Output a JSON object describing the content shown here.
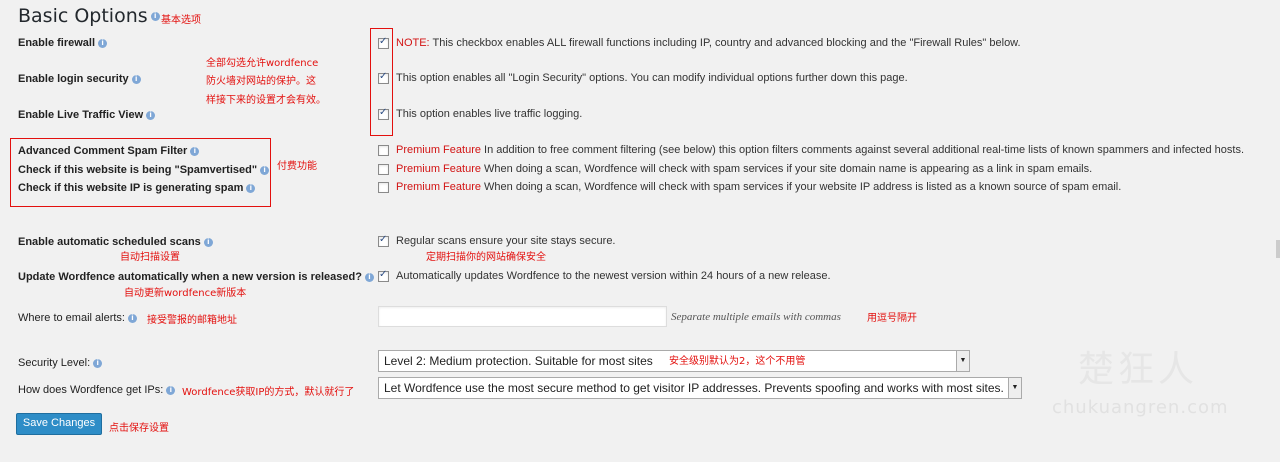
{
  "page": {
    "title": "Basic Options",
    "title_note": "基本选项"
  },
  "rows": {
    "firewall": {
      "label": "Enable firewall",
      "note": "NOTE:",
      "desc": " This checkbox enables ALL firewall functions including IP, country and advanced blocking and the \"Firewall Rules\" below.",
      "checked": true
    },
    "login": {
      "label": "Enable login security",
      "desc": "This option enables all \"Login Security\" options. You can modify individual options further down this page.",
      "checked": true
    },
    "traffic": {
      "label": "Enable Live Traffic View",
      "desc": "This option enables live traffic logging.",
      "checked": true
    },
    "comment_spam": {
      "label": "Advanced Comment Spam Filter",
      "premium": "Premium Feature",
      "desc": " In addition to free comment filtering (see below) this option filters comments against several additional real-time lists of known spammers and infected hosts.",
      "checked": false
    },
    "spamvertised": {
      "label": "Check if this website is being \"Spamvertised\"",
      "premium": "Premium Feature",
      "desc": " When doing a scan, Wordfence will check with spam services if your site domain name is appearing as a link in spam emails.",
      "checked": false
    },
    "ip_spam": {
      "label": "Check if this website IP is generating spam",
      "premium": "Premium Feature",
      "desc": " When doing a scan, Wordfence will check with spam services if your website IP address is listed as a known source of spam email.",
      "checked": false
    },
    "scans": {
      "label": "Enable automatic scheduled scans",
      "desc": "Regular scans ensure your site stays secure.",
      "checked": true
    },
    "autoupdate": {
      "label": "Update Wordfence automatically when a new version is released?",
      "desc": "Automatically updates Wordfence to the newest version within 24 hours of a new release.",
      "checked": true
    },
    "email": {
      "label": "Where to email alerts:",
      "value": "",
      "hint": "Separate multiple emails with commas"
    },
    "security_level": {
      "label": "Security Level:",
      "selected": "Level 2: Medium protection. Suitable for most sites"
    },
    "get_ips": {
      "label": "How does Wordfence get IPs:",
      "selected": "Let Wordfence use the most secure method to get visitor IP addresses. Prevents spoofing and works with most sites."
    }
  },
  "save_label": "Save Changes",
  "annotations": {
    "firewall_1": "全部勾选允许wordfence",
    "firewall_2": "防火墙对网站的保护。这",
    "firewall_3": "样接下来的设置才会有效。",
    "premium": "付费功能",
    "scans_label": "自动扫描设置",
    "scans_desc": "定期扫描你的网站确保安全",
    "autoupdate": "自动更新wordfence新版本",
    "email": "接受警报的邮箱地址",
    "email_hint": "用逗号隔开",
    "security_level": "安全级别默认为2，这个不用管",
    "get_ips": "Wordfence获取IP的方式，默认就行了",
    "save": "点击保存设置"
  },
  "watermark": {
    "brand": "楚狂人",
    "domain": "chukuangren.com"
  },
  "icons": {
    "info": "info-icon",
    "check": "checkmark-icon",
    "dropdown": "triangle-down-icon"
  }
}
